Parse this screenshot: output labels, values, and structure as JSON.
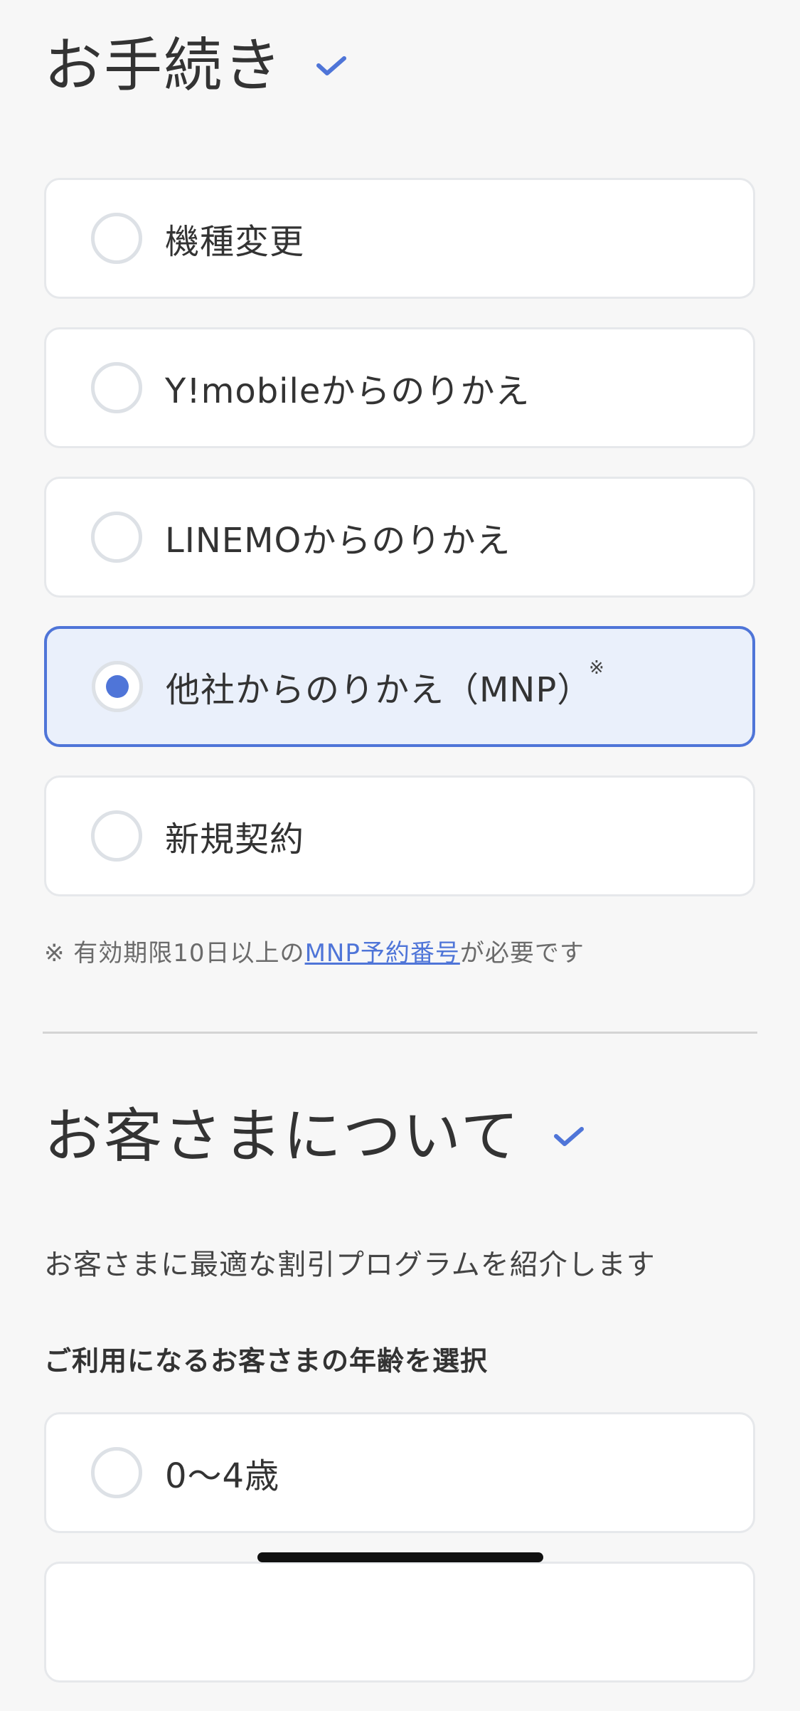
{
  "procedure": {
    "title": "お手続き",
    "options": [
      {
        "label": "機種変更",
        "selected": false
      },
      {
        "label": "Y!mobileからのりかえ",
        "selected": false
      },
      {
        "label": "LINEMOからのりかえ",
        "selected": false
      },
      {
        "label": "他社からのりかえ（MNP）",
        "selected": true,
        "mark": "※"
      },
      {
        "label": "新規契約",
        "selected": false
      }
    ],
    "note": {
      "prefix": "※ 有効期限10日以上の",
      "link": "MNP予約番号",
      "suffix": "が必要です"
    }
  },
  "customer": {
    "title": "お客さまについて",
    "description": "お客さまに最適な割引プログラムを紹介します",
    "age_heading": "ご利用になるお客さまの年齢を選択",
    "age_options": [
      {
        "label": "0〜4歳",
        "selected": false
      }
    ]
  },
  "colors": {
    "accent": "#4f75d8",
    "selected_bg": "#eaf0fb",
    "background": "#f7f7f7"
  }
}
